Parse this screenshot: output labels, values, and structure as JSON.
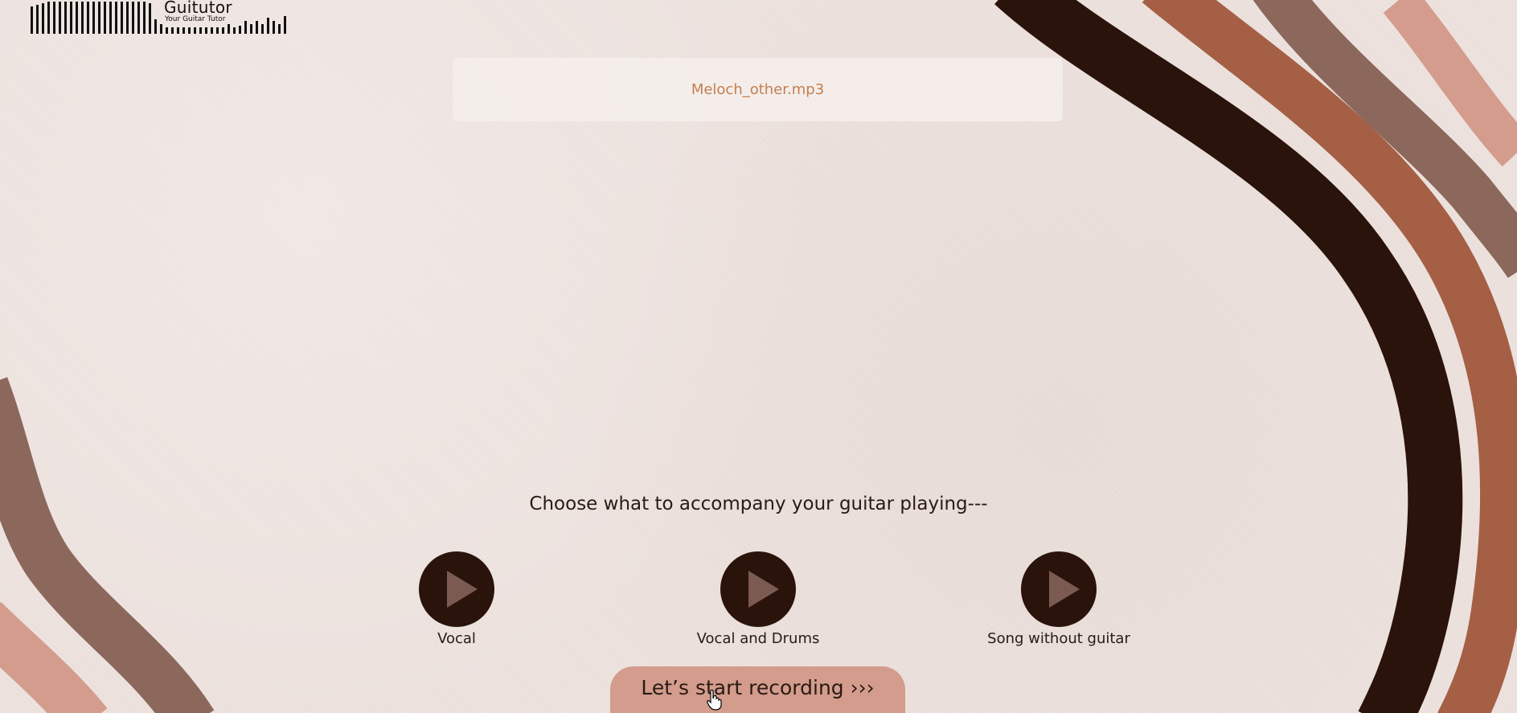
{
  "app": {
    "logo_title": "Guitutor",
    "logo_tagline": "Your Guitar Tutor"
  },
  "file": {
    "name": "Meloch_other.mp3"
  },
  "main": {
    "prompt": "Choose what to accompany your guitar playing---",
    "options": [
      {
        "label": "Vocal",
        "icon": "play-icon"
      },
      {
        "label": "Vocal and Drums",
        "icon": "play-icon"
      },
      {
        "label": "Song without guitar",
        "icon": "play-icon"
      }
    ],
    "start_button": "Let’s start recording ›››"
  },
  "colors": {
    "background": "#ede2de",
    "dark_brown": "#2a130b",
    "rust": "#a45f45",
    "taupe": "#8c675c",
    "rose": "#d39c8d",
    "file_text": "#c47f50"
  }
}
